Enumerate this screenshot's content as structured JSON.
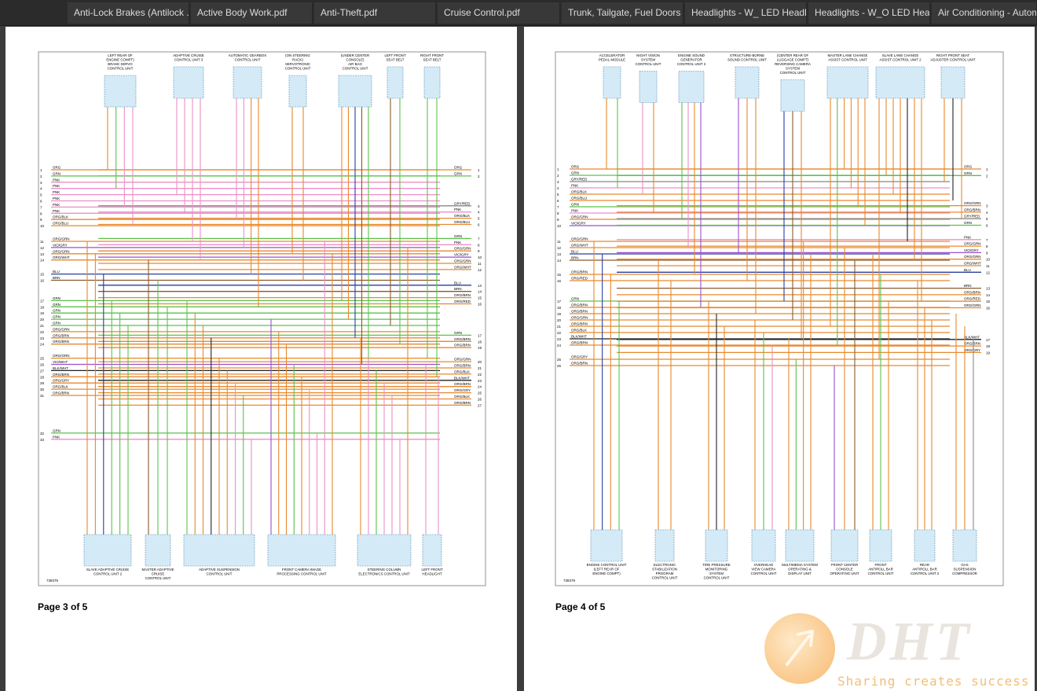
{
  "tabs": [
    {
      "label": "Anti-Lock Brakes (Antilock ..."
    },
    {
      "label": "Active Body Work.pdf"
    },
    {
      "label": "Anti-Theft.pdf"
    },
    {
      "label": "Cruise Control.pdf"
    },
    {
      "label": "Trunk, Tailgate, Fuel Doors -..."
    },
    {
      "label": "Headlights - W_ LED Headli..."
    },
    {
      "label": "Headlights - W_O LED Head..."
    },
    {
      "label": "Air Conditioning - Autom"
    }
  ],
  "pages": [
    {
      "label": "Page 3 of 5",
      "diagram_id": "738376",
      "top_components": [
        {
          "name": "LEFT REAR OF ENGINE COMPT) BRAKE SERVO CONTROL UNIT",
          "lines": [
            "LEFT REAR OF",
            "ENGINE COMPT)",
            "BRAKE SERVO",
            "CONTROL UNIT"
          ]
        },
        {
          "name": "ADAPTIVE CRUISE CONTROL UNIT 3",
          "lines": [
            "ADAPTIVE CRUISE",
            "CONTROL UNIT 3"
          ]
        },
        {
          "name": "AUTOMATIC GEARBOX CONTROL UNIT",
          "lines": [
            "AUTOMATIC GEARBOX",
            "CONTROL UNIT"
          ]
        },
        {
          "name": "(ON STEERING RACK) SERVOTRONIC CONTROL UNIT",
          "lines": [
            "(ON STEERING",
            "RACK)",
            "SERVOTRONIC",
            "CONTROL UNIT"
          ]
        },
        {
          "name": "(UNDER CENTER CONSOLE) AIR BAG CONTROL UNIT",
          "lines": [
            "(UNDER CENTER",
            "CONSOLE)",
            "AIR BAG",
            "CONTROL UNIT"
          ]
        },
        {
          "name": "LEFT FRONT SEAT BELT",
          "lines": [
            "LEFT FRONT",
            "SEAT BELT"
          ]
        },
        {
          "name": "RIGHT FRONT SEAT BELT",
          "lines": [
            "RIGHT FRONT",
            "SEAT BELT"
          ]
        }
      ],
      "bottom_components": [
        {
          "name": "SLAVE ADAPTIVE CRUISE CONTROL UNIT 2",
          "lines": [
            "SLAVE ADAPTIVE CRUISE",
            "CONTROL UNIT 2"
          ]
        },
        {
          "name": "MASTER ADAPTIVE CRUISE CONTROL UNIT",
          "lines": [
            "MASTER ADAPTIVE",
            "CRUISE",
            "CONTROL UNIT"
          ]
        },
        {
          "name": "ADAPTIVE SUSPENSION CONTROL UNIT",
          "lines": [
            "ADAPTIVE SUSPENSION",
            "CONTROL UNIT"
          ]
        },
        {
          "name": "FRONT CAMERA IMAGE PROCESSING CONTROL UNIT",
          "lines": [
            "FRONT CAMERA IMAGE",
            "PROCESSING CONTROL UNIT"
          ]
        },
        {
          "name": "STEERING COLUMN ELECTRONICS CONTROL UNIT",
          "lines": [
            "STEERING COLUMN",
            "ELECTRONICS CONTROL UNIT"
          ]
        },
        {
          "name": "LEFT FRONT HEADLIGHT",
          "lines": [
            "LEFT FRONT",
            "HEADLIGHT"
          ]
        }
      ],
      "left_wires": [
        {
          "num": "1",
          "color": "ORG"
        },
        {
          "num": "2",
          "color": "GRN"
        },
        {
          "num": "3",
          "color": "PNK"
        },
        {
          "num": "4",
          "color": "PNK"
        },
        {
          "num": "5",
          "color": "PNK"
        },
        {
          "num": "6",
          "color": "PNK"
        },
        {
          "num": "7",
          "color": "PNK"
        },
        {
          "num": "8",
          "color": "PNK"
        },
        {
          "num": "9",
          "color": "ORG/BLK"
        },
        {
          "num": "10",
          "color": "ORG/BLU"
        },
        {
          "num": "11",
          "color": "ORG/GRN"
        },
        {
          "num": "12",
          "color": "VIO/GRY"
        },
        {
          "num": "13",
          "color": "ORG/GRN"
        },
        {
          "num": "14",
          "color": "ORG/WHT"
        },
        {
          "num": "15",
          "color": "BLU"
        },
        {
          "num": "16",
          "color": "BRN"
        },
        {
          "num": "17",
          "color": "GRN"
        },
        {
          "num": "18",
          "color": "GRN"
        },
        {
          "num": "19",
          "color": "GRN"
        },
        {
          "num": "20",
          "color": "GRN"
        },
        {
          "num": "21",
          "color": "GRN"
        },
        {
          "num": "22",
          "color": "ORG/GRN"
        },
        {
          "num": "23",
          "color": "ORG/BRN"
        },
        {
          "num": "24",
          "color": "ORG/BRN"
        },
        {
          "num": "25",
          "color": "ORG/GRN"
        },
        {
          "num": "26",
          "color": "VIO/WHT"
        },
        {
          "num": "27",
          "color": "BLK/WHT"
        },
        {
          "num": "28",
          "color": "ORG/BRN"
        },
        {
          "num": "29",
          "color": "ORG/GRY"
        },
        {
          "num": "30",
          "color": "ORG/BLK"
        },
        {
          "num": "31",
          "color": "ORG/BRN"
        },
        {
          "num": "32",
          "color": "GRN"
        },
        {
          "num": "33",
          "color": "PNK"
        }
      ],
      "right_wires": [
        {
          "num": "1",
          "color": "ORG"
        },
        {
          "num": "2",
          "color": "GRN"
        },
        {
          "num": "3",
          "color": "GRY/RED"
        },
        {
          "num": "4",
          "color": "PNK"
        },
        {
          "num": "5",
          "color": "ORG/BLK"
        },
        {
          "num": "6",
          "color": "ORG/BLU"
        },
        {
          "num": "7",
          "color": "GRN"
        },
        {
          "num": "8",
          "color": "PNK"
        },
        {
          "num": "9",
          "color": "ORG/GRN"
        },
        {
          "num": "10",
          "color": "VIO/GRY"
        },
        {
          "num": "11",
          "color": "ORG/GRN"
        },
        {
          "num": "12",
          "color": "ORG/WHT"
        },
        {
          "num": "13",
          "color": "BLU"
        },
        {
          "num": "14",
          "color": "BRN"
        },
        {
          "num": "15",
          "color": "ORG/BRN"
        },
        {
          "num": "16",
          "color": "ORG/RED"
        },
        {
          "num": "17",
          "color": "GRN"
        },
        {
          "num": "18",
          "color": "ORG/BRN"
        },
        {
          "num": "19",
          "color": "ORG/BRN"
        },
        {
          "num": "20",
          "color": "ORG/GRN"
        },
        {
          "num": "21",
          "color": "ORG/BRN"
        },
        {
          "num": "22",
          "color": "ORG/BLK"
        },
        {
          "num": "23",
          "color": "BLK/WHT"
        },
        {
          "num": "24",
          "color": "ORG/BRN"
        },
        {
          "num": "25",
          "color": "ORG/GRY"
        },
        {
          "num": "26",
          "color": "ORG/BLK"
        },
        {
          "num": "27",
          "color": "ORG/BRN"
        }
      ]
    },
    {
      "label": "Page 4 of 5",
      "diagram_id": "738379",
      "top_components": [
        {
          "name": "ACCELERATOR PEDAL MODULE",
          "lines": [
            "ACCELERATOR",
            "PEDAL MODULE"
          ]
        },
        {
          "name": "NIGHT VISION SYSTEM CONTROL UNIT",
          "lines": [
            "NIGHT VISION",
            "SYSTEM",
            "CONTROL UNIT"
          ]
        },
        {
          "name": "ENGINE SOUND GENERATOR CONTROL UNIT 2",
          "lines": [
            "ENGINE SOUND",
            "GENERATOR",
            "CONTROL UNIT 2"
          ]
        },
        {
          "name": "STRUCTURE-BORNE SOUND CONTROL UNIT",
          "lines": [
            "STRUCTURE-BORNE",
            "SOUND CONTROL UNIT"
          ]
        },
        {
          "name": "(CENTER REAR OF LUGGAGE COMPT) REVERSING CAMERA SYSTEM CONTROL UNIT",
          "lines": [
            "(CENTER REAR OF",
            "LUGGAGE COMPT)",
            "REVERSING CAMERA",
            "SYSTEM",
            "CONTROL UNIT"
          ]
        },
        {
          "name": "MASTER LANE CHANGE ASSIST CONTROL UNIT",
          "lines": [
            "MASTER LANE CHANGE",
            "ASSIST CONTROL UNIT"
          ]
        },
        {
          "name": "SLAVE LANE CHANGE ASSIST CONTROL UNIT 2",
          "lines": [
            "SLAVE LANE CHANGE",
            "ASSIST CONTROL UNIT 2"
          ]
        },
        {
          "name": "RIGHT FRONT SEAT ADJUSTER CONTROL UNIT",
          "lines": [
            "RIGHT FRONT SEAT",
            "ADJUSTER CONTROL UNIT"
          ]
        }
      ],
      "bottom_components": [
        {
          "name": "ENGINE CONTROL UNIT (LEFT REAR OF ENGINE COMPT)",
          "lines": [
            "ENGINE CONTROL UNIT",
            "(LEFT REAR OF",
            "ENGINE COMPT)"
          ]
        },
        {
          "name": "ELECTRONIC STABILIZATION PROGRAM CONTROL UNIT",
          "lines": [
            "ELECTRONIC",
            "STABILIZATION",
            "PROGRAM",
            "CONTROL UNIT"
          ]
        },
        {
          "name": "TIRE PRESSURE MONITORING SYSTEM CONTROL UNIT",
          "lines": [
            "TIRE PRESSURE",
            "MONITORING",
            "SYSTEM",
            "CONTROL UNIT"
          ]
        },
        {
          "name": "OVERHEAD VIEW CAMERA CONTROL UNIT",
          "lines": [
            "OVERHEAD",
            "VIEW CAMERA",
            "CONTROL UNIT"
          ]
        },
        {
          "name": "MULTIMEDIA SYSTEM OPERATING & DISPLAY UNIT",
          "lines": [
            "MULTIMEDIA SYSTEM",
            "OPERATING &",
            "DISPLAY UNIT"
          ]
        },
        {
          "name": "FRONT CENTER CONSOLE OPERATING UNIT",
          "lines": [
            "FRONT CENTER",
            "CONSOLE",
            "OPERATING UNIT"
          ]
        },
        {
          "name": "FRONT ANTIROLL BAR CONTROL UNIT",
          "lines": [
            "FRONT",
            "ANTIROLL BAR",
            "CONTROL UNIT"
          ]
        },
        {
          "name": "REAR ANTIROLL BAR CONTROL UNIT 2",
          "lines": [
            "REAR",
            "ANTIROLL BAR",
            "CONTROL UNIT 2"
          ]
        },
        {
          "name": "GAS SUSPENSION COMPRESSOR",
          "lines": [
            "GAS",
            "SUSPENSION",
            "COMPRESSOR"
          ]
        }
      ],
      "left_wires": [
        {
          "num": "1",
          "color": "ORG"
        },
        {
          "num": "2",
          "color": "GRN"
        },
        {
          "num": "3",
          "color": "GRY/RED"
        },
        {
          "num": "4",
          "color": "PNK"
        },
        {
          "num": "5",
          "color": "ORG/BLK"
        },
        {
          "num": "6",
          "color": "ORG/BLU"
        },
        {
          "num": "7",
          "color": "GRN"
        },
        {
          "num": "8",
          "color": "PNK"
        },
        {
          "num": "9",
          "color": "ORG/GRN"
        },
        {
          "num": "10",
          "color": "VIO/GRY"
        },
        {
          "num": "11",
          "color": "ORG/GRN"
        },
        {
          "num": "12",
          "color": "ORG/WHT"
        },
        {
          "num": "13",
          "color": "BLU"
        },
        {
          "num": "14",
          "color": "BRN"
        },
        {
          "num": "15",
          "color": "ORG/BRN"
        },
        {
          "num": "16",
          "color": "ORG/RED"
        },
        {
          "num": "17",
          "color": "GRN"
        },
        {
          "num": "18",
          "color": "ORG/BRN"
        },
        {
          "num": "19",
          "color": "ORG/BRN"
        },
        {
          "num": "20",
          "color": "ORG/GRN"
        },
        {
          "num": "21",
          "color": "ORG/BRN"
        },
        {
          "num": "22",
          "color": "ORG/BLK"
        },
        {
          "num": "23",
          "color": "BLK/WHT"
        },
        {
          "num": "24",
          "color": "ORG/BRN"
        },
        {
          "num": "25",
          "color": "ORG/GRY"
        },
        {
          "num": "26",
          "color": "ORG/BRN"
        }
      ],
      "right_wires": [
        {
          "num": "1",
          "color": "ORG"
        },
        {
          "num": "2",
          "color": "GRN"
        },
        {
          "num": "3",
          "color": "ORG/GRN"
        },
        {
          "num": "4",
          "color": "ORG/BRN"
        },
        {
          "num": "5",
          "color": "GRY/RED"
        },
        {
          "num": "6",
          "color": "GRN"
        },
        {
          "num": "7",
          "color": "PNK"
        },
        {
          "num": "8",
          "color": "ORG/GRN"
        },
        {
          "num": "9",
          "color": "VIO/GRY"
        },
        {
          "num": "10",
          "color": "ORG/GRN"
        },
        {
          "num": "11",
          "color": "ORG/WHT"
        },
        {
          "num": "12",
          "color": "BLU"
        },
        {
          "num": "13",
          "color": "BRN"
        },
        {
          "num": "14",
          "color": "ORG/BRN"
        },
        {
          "num": "15",
          "color": "ORG/RED"
        },
        {
          "num": "16",
          "color": "ORG/GRN"
        },
        {
          "num": "17",
          "color": "BLK/WHT"
        },
        {
          "num": "18",
          "color": "ORG/BRN"
        },
        {
          "num": "19",
          "color": "ORG/GRY"
        }
      ]
    }
  ],
  "wire_colors": {
    "ORG": "#e8892c",
    "GRN": "#5cc24a",
    "PNK": "#ec8fc6",
    "VIO": "#9b4fd1",
    "BLU": "#2a3f9e",
    "BRN": "#8b5a2b",
    "BLK": "#222222",
    "GRY": "#888888",
    "RED": "#d62a2a",
    "WHT": "#bbbbbb"
  },
  "watermark": {
    "letters": "DHT",
    "slogan": "Sharing creates success",
    "icon": "arrow-logo-icon"
  },
  "viewer_background": "#3c3c3c"
}
